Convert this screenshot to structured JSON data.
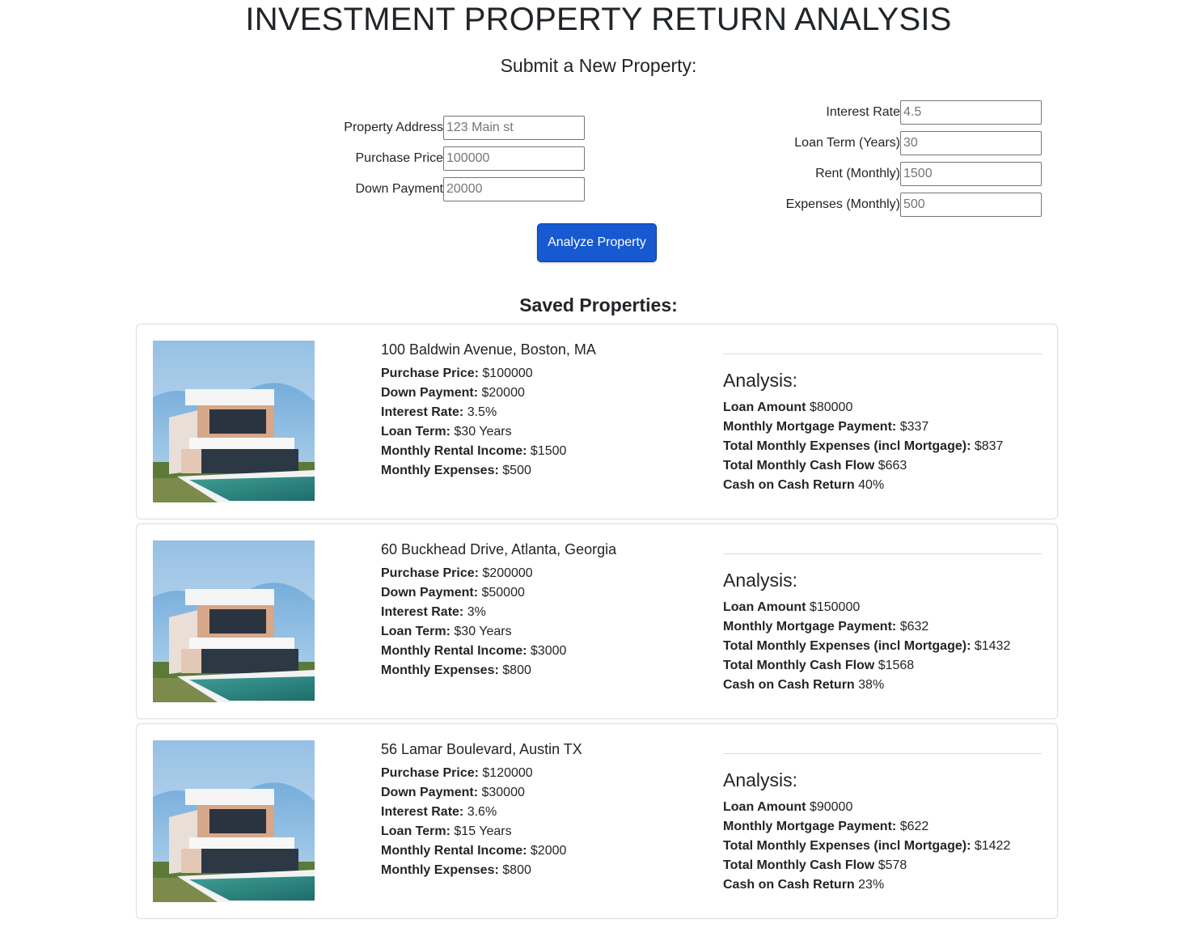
{
  "page": {
    "title": "INVESTMENT PROPERTY RETURN ANALYSIS",
    "form_title": "Submit a New Property:",
    "saved_title": "Saved Properties:"
  },
  "form": {
    "left_fields": [
      {
        "label": "Property Address",
        "placeholder": "123 Main st"
      },
      {
        "label": "Purchase Price",
        "placeholder": "100000"
      },
      {
        "label": "Down Payment",
        "placeholder": "20000"
      }
    ],
    "right_fields": [
      {
        "label": "Interest Rate",
        "placeholder": "4.5"
      },
      {
        "label": "Loan Term (Years)",
        "placeholder": "30"
      },
      {
        "label": "Rent (Monthly)",
        "placeholder": "1500"
      },
      {
        "label": "Expenses (Monthly)",
        "placeholder": "500"
      }
    ],
    "submit_label": "Analyze Property"
  },
  "labels": {
    "purchase_price": "Purchase Price:",
    "down_payment": "Down Payment:",
    "interest_rate": "Interest Rate:",
    "loan_term": "Loan Term:",
    "rental_income": "Monthly Rental Income:",
    "monthly_expenses": "Monthly Expenses:",
    "analysis_title": "Analysis:",
    "loan_amount": "Loan Amount",
    "mortgage_payment": "Monthly Mortgage Payment:",
    "total_expenses": "Total Monthly Expenses (incl Mortgage):",
    "cash_flow": "Total Monthly Cash Flow",
    "coc_return": "Cash on Cash Return"
  },
  "properties": [
    {
      "address": "100 Baldwin Avenue, Boston, MA",
      "purchase_price": "$100000",
      "down_payment": "$20000",
      "interest_rate": "3.5%",
      "loan_term": "$30 Years",
      "rental_income": "$1500",
      "monthly_expenses": "$500",
      "loan_amount": "$80000",
      "mortgage_payment": "$337",
      "total_expenses": "$837",
      "cash_flow": "$663",
      "coc_return": "40%"
    },
    {
      "address": "60 Buckhead Drive, Atlanta, Georgia",
      "purchase_price": "$200000",
      "down_payment": "$50000",
      "interest_rate": "3%",
      "loan_term": "$30 Years",
      "rental_income": "$3000",
      "monthly_expenses": "$800",
      "loan_amount": "$150000",
      "mortgage_payment": "$632",
      "total_expenses": "$1432",
      "cash_flow": "$1568",
      "coc_return": "38%"
    },
    {
      "address": "56 Lamar Boulevard, Austin TX",
      "purchase_price": "$120000",
      "down_payment": "$30000",
      "interest_rate": "3.6%",
      "loan_term": "$15 Years",
      "rental_income": "$2000",
      "monthly_expenses": "$800",
      "loan_amount": "$90000",
      "mortgage_payment": "$622",
      "total_expenses": "$1422",
      "cash_flow": "$578",
      "coc_return": "23%"
    }
  ],
  "colors": {
    "button": "#1659d1",
    "text": "#212529",
    "border": "#dcdcdc"
  }
}
